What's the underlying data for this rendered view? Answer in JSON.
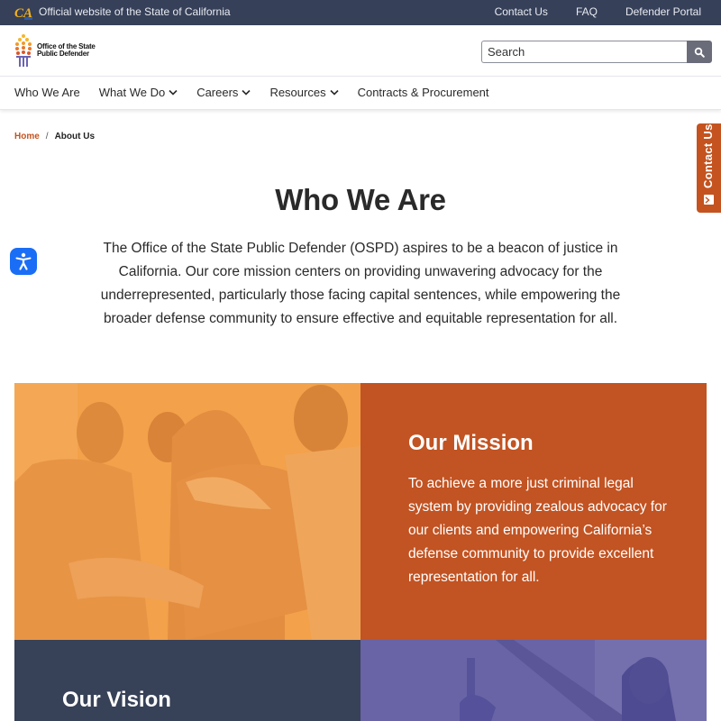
{
  "utility_bar": {
    "official_text": "Official website of the State of California",
    "links": [
      "Contact Us",
      "FAQ",
      "Defender Portal"
    ]
  },
  "header": {
    "logo_line1": "Office of the State",
    "logo_line2": "Public Defender",
    "search_placeholder": "Search"
  },
  "nav": {
    "items": [
      {
        "label": "Who We Are",
        "dropdown": false
      },
      {
        "label": "What We Do",
        "dropdown": true
      },
      {
        "label": "Careers",
        "dropdown": true
      },
      {
        "label": "Resources",
        "dropdown": true
      },
      {
        "label": "Contracts & Procurement",
        "dropdown": false
      }
    ]
  },
  "breadcrumb": {
    "home": "Home",
    "separator": "/",
    "current": "About Us"
  },
  "contact_tab": {
    "label": "Contact Us"
  },
  "main": {
    "title": "Who We Are",
    "intro": "The Office of the State Public Defender (OSPD) aspires to be a beacon of justice in California. Our core mission centers on providing unwavering advocacy for the underrepresented, particularly those facing capital sentences, while empowering the broader defense community to ensure effective and equitable representation for all."
  },
  "mission": {
    "heading": "Our Mission",
    "body": "To achieve a more just criminal legal system by providing zealous advocacy for our clients and empowering California’s defense community to provide excellent representation for all."
  },
  "vision": {
    "heading": "Our Vision"
  },
  "colors": {
    "utility_bg": "#364058",
    "accent_orange": "#c25322",
    "image_orange": "#f09a42",
    "vision_navy": "#374157",
    "image_purple": "#6a66a6",
    "a11y_blue": "#1a6ef5"
  }
}
